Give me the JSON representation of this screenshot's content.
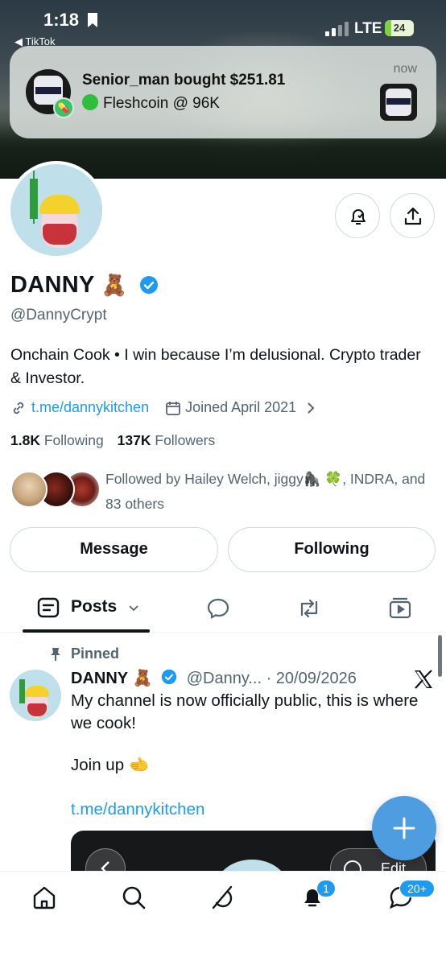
{
  "status_bar": {
    "time": "1:18",
    "back_app": "◀ TikTok",
    "network": "LTE",
    "battery": "24"
  },
  "notification": {
    "title": "Senior_man bought $251.81",
    "body": "Fleshcoin @ 96K",
    "time": "now"
  },
  "profile": {
    "name": "DANNY",
    "name_emoji": "🧸",
    "handle": "@DannyCrypt",
    "bio": "Onchain Cook • I win because I’m delusional. Crypto trader & Investor.",
    "link": "t.me/dannykitchen",
    "joined": "Joined April 2021",
    "following_count": "1.8K",
    "following_label": "Following",
    "followers_count": "137K",
    "followers_label": "Followers",
    "followed_by": "Followed by Hailey Welch, jiggy🦍 🍀, INDRA, and 83 others"
  },
  "actions": {
    "message": "Message",
    "following": "Following"
  },
  "tabs": {
    "posts": "Posts"
  },
  "pinned_post": {
    "pinned_label": "Pinned",
    "author": "DANNY",
    "author_emoji": "🧸",
    "meta": "@Danny... · 20/09/2026",
    "text": "My channel is now officially public, this is where we cook!",
    "line2": "Join up 🫲",
    "link": "t.me/dannykitchen",
    "media_edit": "Edit"
  },
  "bottom_nav": {
    "notif_badge": "1",
    "msg_badge": "20+"
  },
  "colors": {
    "accent": "#1d9bf0",
    "fab": "#4d9de0",
    "text": "#0f1419",
    "muted": "#536471"
  }
}
